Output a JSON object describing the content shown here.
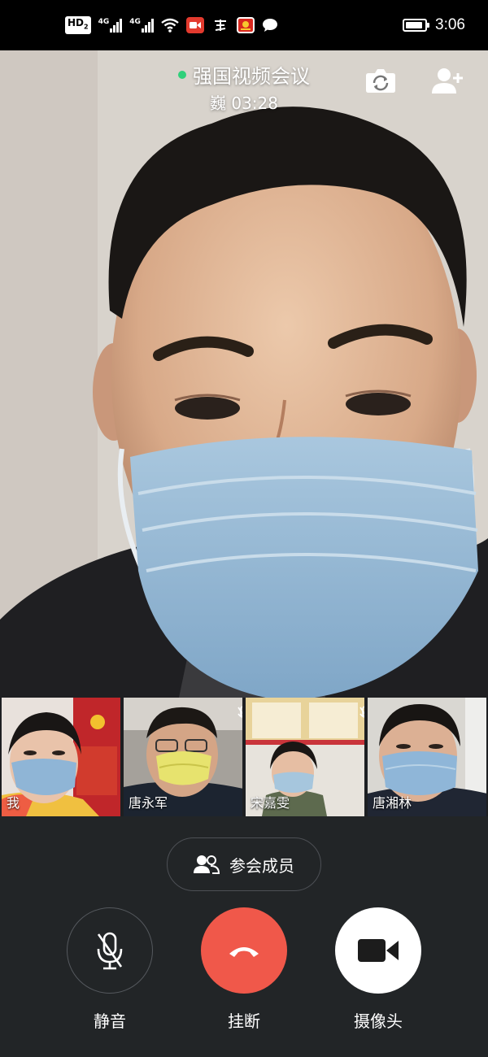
{
  "status_bar": {
    "hd_label": "HD",
    "hd_sub": "2",
    "network_1": "4G",
    "network_2": "4G",
    "time": "3:06",
    "icons": [
      "signal-icon",
      "wifi-icon",
      "video-app-icon",
      "xuexi-app-icon",
      "party-app-icon",
      "chat-bubble-icon",
      "battery-icon"
    ]
  },
  "call": {
    "title": "强国视频会议",
    "timer": "巍 03:28",
    "status_color": "#2fd07a"
  },
  "participants": [
    {
      "name": "我",
      "muted": false
    },
    {
      "name": "唐永军",
      "muted": true
    },
    {
      "name": "宋嘉雯",
      "muted": true
    },
    {
      "name": "唐湘林",
      "muted": false
    }
  ],
  "controls": {
    "members_label": "参会成员",
    "mute_label": "静音",
    "hangup_label": "挂断",
    "camera_label": "摄像头",
    "hangup_color": "#f0584a"
  }
}
